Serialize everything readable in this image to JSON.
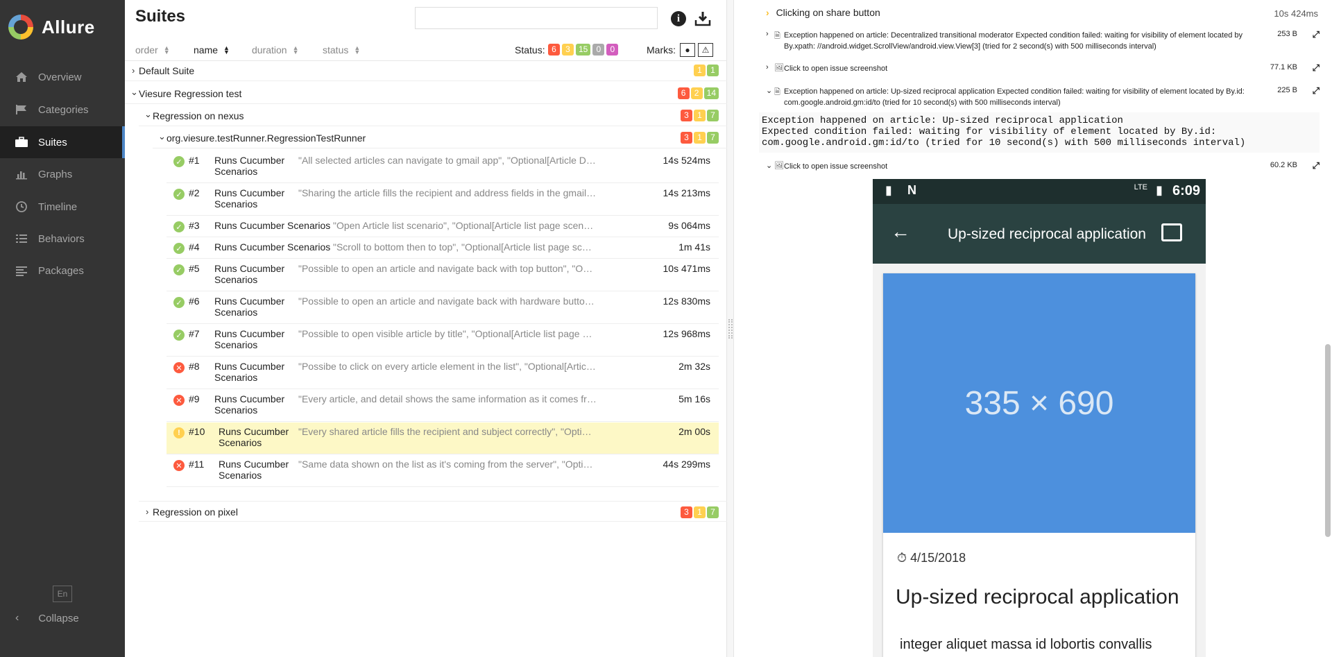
{
  "app": {
    "name": "Allure"
  },
  "sidebar": {
    "items": [
      {
        "label": "Overview",
        "icon": "home-icon"
      },
      {
        "label": "Categories",
        "icon": "flag-icon"
      },
      {
        "label": "Suites",
        "icon": "briefcase-icon",
        "active": true
      },
      {
        "label": "Graphs",
        "icon": "bar-chart-icon"
      },
      {
        "label": "Timeline",
        "icon": "clock-icon"
      },
      {
        "label": "Behaviors",
        "icon": "list-icon"
      },
      {
        "label": "Packages",
        "icon": "align-left-icon"
      }
    ],
    "lang": "En",
    "collapse": "Collapse"
  },
  "suites": {
    "title": "Suites",
    "search_placeholder": "",
    "sort": {
      "order": "order",
      "name": "name",
      "duration": "duration",
      "status": "status"
    },
    "status_label": "Status:",
    "status_counts": {
      "failed": "6",
      "broken": "3",
      "passed": "15",
      "skipped": "0",
      "unknown": "0"
    },
    "marks_label": "Marks:",
    "tree": {
      "default_suite": {
        "name": "Default Suite",
        "broken": "1",
        "passed": "1"
      },
      "viesure": {
        "name": "Viesure Regression test",
        "failed": "6",
        "broken": "2",
        "passed": "14"
      },
      "nexus": {
        "name": "Regression on nexus",
        "failed": "3",
        "broken": "1",
        "passed": "7"
      },
      "runner": {
        "name": "org.viesure.testRunner.RegressionTestRunner",
        "failed": "3",
        "broken": "1",
        "passed": "7"
      },
      "pixel": {
        "name": "Regression on pixel",
        "failed": "3",
        "broken": "1",
        "passed": "7"
      }
    },
    "tests": [
      {
        "num": "#1",
        "title": "Runs Cucumber Scenarios",
        "params": "\"All selected articles can navigate to gmail app\", \"Optional[Article Detail page f...",
        "duration": "14s 524ms",
        "status": "passed"
      },
      {
        "num": "#2",
        "title": "Runs Cucumber Scenarios",
        "params": "\"Sharing the article fills the recipient and address fields in the gmail application\", \"O...",
        "duration": "14s 213ms",
        "status": "passed"
      },
      {
        "num": "#3",
        "title": "Runs Cucumber Scenarios",
        "params": "\"Open Article list scenario\", \"Optional[Article list page scenarios]\", nexus",
        "duration": "9s 064ms",
        "status": "passed"
      },
      {
        "num": "#4",
        "title": "Runs Cucumber Scenarios",
        "params": "\"Scroll to bottom then to top\", \"Optional[Article list page scenarios]\", nexus",
        "duration": "1m 41s",
        "status": "passed"
      },
      {
        "num": "#5",
        "title": "Runs Cucumber Scenarios",
        "params": "\"Possible to open an article and navigate back with top button\", \"Optional[Article l...",
        "duration": "10s 471ms",
        "status": "passed"
      },
      {
        "num": "#6",
        "title": "Runs Cucumber Scenarios",
        "params": "\"Possible to open an article and navigate back with hardware button\", \"Optional[A...",
        "duration": "12s 830ms",
        "status": "passed"
      },
      {
        "num": "#7",
        "title": "Runs Cucumber Scenarios",
        "params": "\"Possible to open visible article by title\", \"Optional[Article list page scenarios]...",
        "duration": "12s 968ms",
        "status": "passed"
      },
      {
        "num": "#8",
        "title": "Runs Cucumber Scenarios",
        "params": "\"Possibe to click on every article element in the list\", \"Optional[Article list page sce...",
        "duration": "2m 32s",
        "status": "failed"
      },
      {
        "num": "#9",
        "title": "Runs Cucumber Scenarios",
        "params": "\"Every article, and detail shows the same information as it comes from the backend\", \"...",
        "duration": "5m 16s",
        "status": "failed"
      },
      {
        "num": "#10",
        "title": "Runs Cucumber Scenarios",
        "params": "\"Every shared article fills the recipient and subject correctly\", \"Optional[Article list p...",
        "duration": "2m 00s",
        "status": "broken",
        "selected": true
      },
      {
        "num": "#11",
        "title": "Runs Cucumber Scenarios",
        "params": "\"Same data shown on the list as it's coming from the server\", \"Optional[Article li...",
        "duration": "44s 299ms",
        "status": "failed"
      }
    ]
  },
  "detail": {
    "step": {
      "name": "Clicking on share button",
      "duration": "10s 424ms"
    },
    "attachments": [
      {
        "text": "Exception happened on article: Decentralized transitional moderator Expected condition failed: waiting for visibility of element located by By.xpath: //android.widget.ScrollView/android.view.View[3] (tried for 2 second(s) with 500 milliseconds interval)",
        "size": "253 B",
        "expanded": false,
        "icon": "file-text-icon"
      },
      {
        "text": "Click to open issue screenshot",
        "size": "77.1 KB",
        "expanded": false,
        "icon": "image-icon"
      },
      {
        "text": "Exception happened on article: Up-sized reciprocal application Expected condition failed: waiting for visibility of element located by By.id: com.google.android.gm:id/to (tried for 10 second(s) with 500 milliseconds interval)",
        "size": "225 B",
        "expanded": true,
        "icon": "file-text-icon"
      },
      {
        "text": "Click to open issue screenshot",
        "size": "60.2 KB",
        "expanded": true,
        "icon": "image-icon"
      }
    ],
    "code": "Exception happened on article: Up-sized reciprocal application\nExpected condition failed: waiting for visibility of element located by By.id:\ncom.google.android.gm:id/to (tried for 10 second(s) with 500 milliseconds interval)",
    "screenshot": {
      "time": "6:09",
      "net": "LTE",
      "app_title": "Up-sized reciprocal application",
      "image_placeholder": "335 × 690",
      "date": "4/15/2018",
      "title": "Up-sized reciprocal application",
      "body": "integer aliquet massa id lobortis convallis"
    }
  },
  "colors": {
    "failed": "#fd5a3e",
    "broken": "#ffd050",
    "passed": "#97cc64",
    "skipped": "#aaaaaa",
    "unknown": "#d35ebe",
    "sidebar": "#343434",
    "accent": "#4d86c6"
  }
}
